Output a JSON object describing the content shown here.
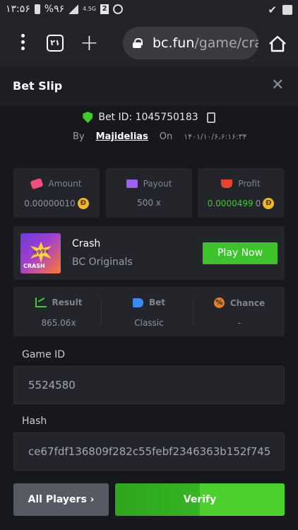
{
  "statusbar": {
    "time": "۱۳:۵۶",
    "battery": "%۹۶",
    "network": "4.5G",
    "notification_count": "2"
  },
  "browser": {
    "tab_count": "۲۱",
    "url_host": "bc.fun",
    "url_path": "/game/cra"
  },
  "slip": {
    "title": "Bet Slip",
    "bet_id": "Bet ID: 1045750183",
    "by_label": "By",
    "user": "Majidelias",
    "on_label": "On",
    "date": "۱۴۰۱/۱۰/۶،۶:۱۶:۳۴"
  },
  "stats": [
    {
      "label": "Amount",
      "value": "0.00000010",
      "coin": "Ð",
      "icon": "amount-icon"
    },
    {
      "label": "Payout",
      "value": "500 x",
      "icon": "payout-icon"
    },
    {
      "label": "Profit",
      "value": "0.0000499",
      "value_color": "#3ecb2b",
      "value_tail": "0",
      "coin": "Ð",
      "icon": "profit-icon"
    }
  ],
  "game": {
    "thumb_mult": "999x",
    "thumb_label": "CRASH",
    "name": "Crash",
    "provider": "BC Originals",
    "play_label": "Play Now"
  },
  "result": [
    {
      "label": "Result",
      "value": "865.06x",
      "icon": "result-icon"
    },
    {
      "label": "Bet",
      "value": "Classic",
      "icon": "bet-icon"
    },
    {
      "label": "Chance",
      "value": "-",
      "icon": "chance-icon"
    }
  ],
  "fields": {
    "game_id_label": "Game ID",
    "game_id_value": "5524580",
    "hash_label": "Hash",
    "hash_value": "ce67fdf136809f282c55febf2346363b152f745"
  },
  "buttons": {
    "all_players": "All Players ›",
    "verify": "Verify"
  },
  "colors": {
    "accent_green": "#3cc42a",
    "background": "#17181b",
    "card": "#23252a"
  }
}
